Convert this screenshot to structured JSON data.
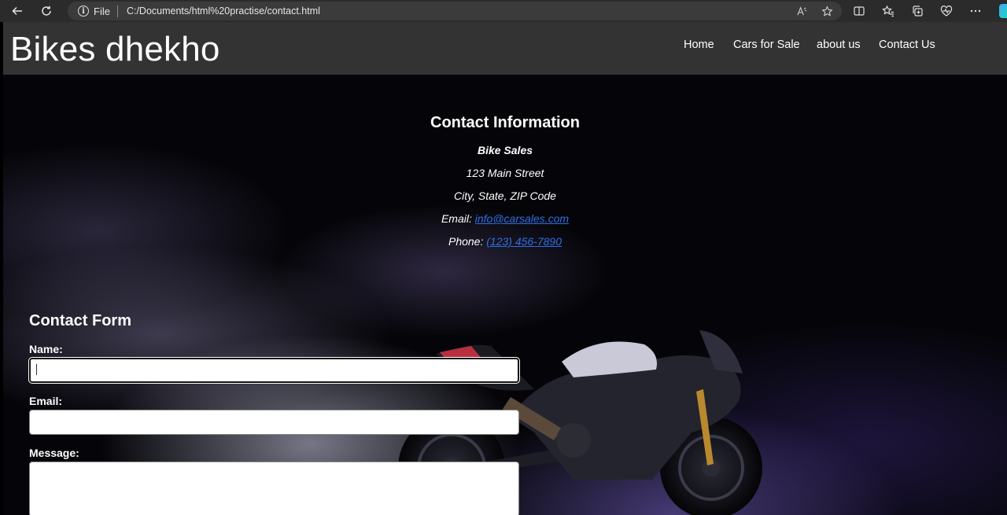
{
  "browser": {
    "file_label": "File",
    "url": "C:/Documents/html%20practise/contact.html"
  },
  "site": {
    "logo": "Bikes dhekho",
    "nav": {
      "home": "Home",
      "cars": "Cars for Sale",
      "about": "about us",
      "contact": "Contact Us"
    }
  },
  "contact_info": {
    "title": "Contact Information",
    "company": "Bike Sales",
    "street": "123 Main Street",
    "city": "City, State, ZIP Code",
    "email_label": "Email:",
    "email": "info@carsales.com",
    "phone_label": "Phone:",
    "phone": "(123) 456-7890"
  },
  "contact_form": {
    "title": "Contact Form",
    "name_label": "Name:",
    "name_value": "",
    "email_label": "Email:",
    "email_value": "",
    "message_label": "Message:",
    "message_value": ""
  }
}
